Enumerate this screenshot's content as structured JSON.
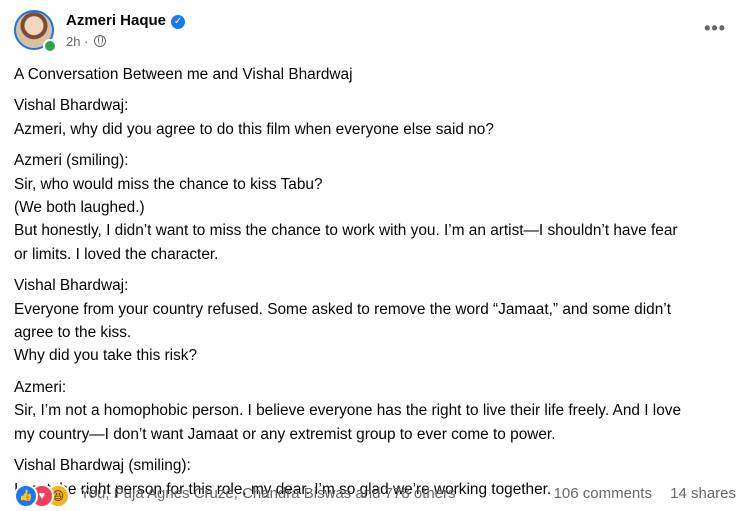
{
  "post": {
    "author": "Azmeri Haque",
    "time": "2h",
    "separator": "·",
    "icons": {
      "verified": "verified-badge-icon",
      "audience": "globe-icon",
      "more": "more-options-icon"
    },
    "lines": [
      {
        "text": "A Conversation Between me and Vishal Bhardwaj",
        "gap_after": true
      },
      {
        "text": "Vishal Bhardwaj:",
        "gap_after": false
      },
      {
        "text": "Azmeri, why did you agree to do this film when everyone else said no?",
        "gap_after": true
      },
      {
        "text": "Azmeri (smiling):",
        "gap_after": false
      },
      {
        "text": "Sir, who would miss the chance to kiss Tabu?",
        "gap_after": false
      },
      {
        "text": "(We both laughed.)",
        "gap_after": false
      },
      {
        "text": "But honestly, I didn’t want to miss the chance to work with you. I’m an artist—I shouldn’t have fear",
        "gap_after": false
      },
      {
        "text": "or limits. I loved the character.",
        "gap_after": true
      },
      {
        "text": "Vishal Bhardwaj:",
        "gap_after": false
      },
      {
        "text": "Everyone from your country refused. Some asked to remove the word “Jamaat,” and some didn’t",
        "gap_after": false
      },
      {
        "text": "agree to the kiss.",
        "gap_after": false
      },
      {
        "text": "Why did you take this risk?",
        "gap_after": true
      },
      {
        "text": "Azmeri:",
        "gap_after": false
      },
      {
        "text": "Sir, I’m not a homophobic person. I believe everyone has the right to live their life freely. And I love",
        "gap_after": false
      },
      {
        "text": "my country—I don’t want Jamaat or any extremist group to ever come to power.",
        "gap_after": true
      },
      {
        "text": "Vishal Bhardwaj (smiling):",
        "gap_after": false
      },
      {
        "text": "I cast the right person for this role, my dear. I’m so glad we’re working together.",
        "gap_after": false
      }
    ]
  },
  "footer": {
    "reaction_icons": [
      "like-icon",
      "love-icon",
      "haha-icon"
    ],
    "reaction_colors": {
      "like": "#1877f2",
      "love": "#f33e58",
      "haha": "#f7b125"
    },
    "reaction_names": "You, Puja Agnes Cruze, Chandra Biswas and 778 others",
    "comments": "106 comments",
    "shares": "14 shares"
  },
  "colors": {
    "text": "#050505",
    "secondary": "#65676b",
    "accent": "#1877f2",
    "online": "#31a24c"
  }
}
